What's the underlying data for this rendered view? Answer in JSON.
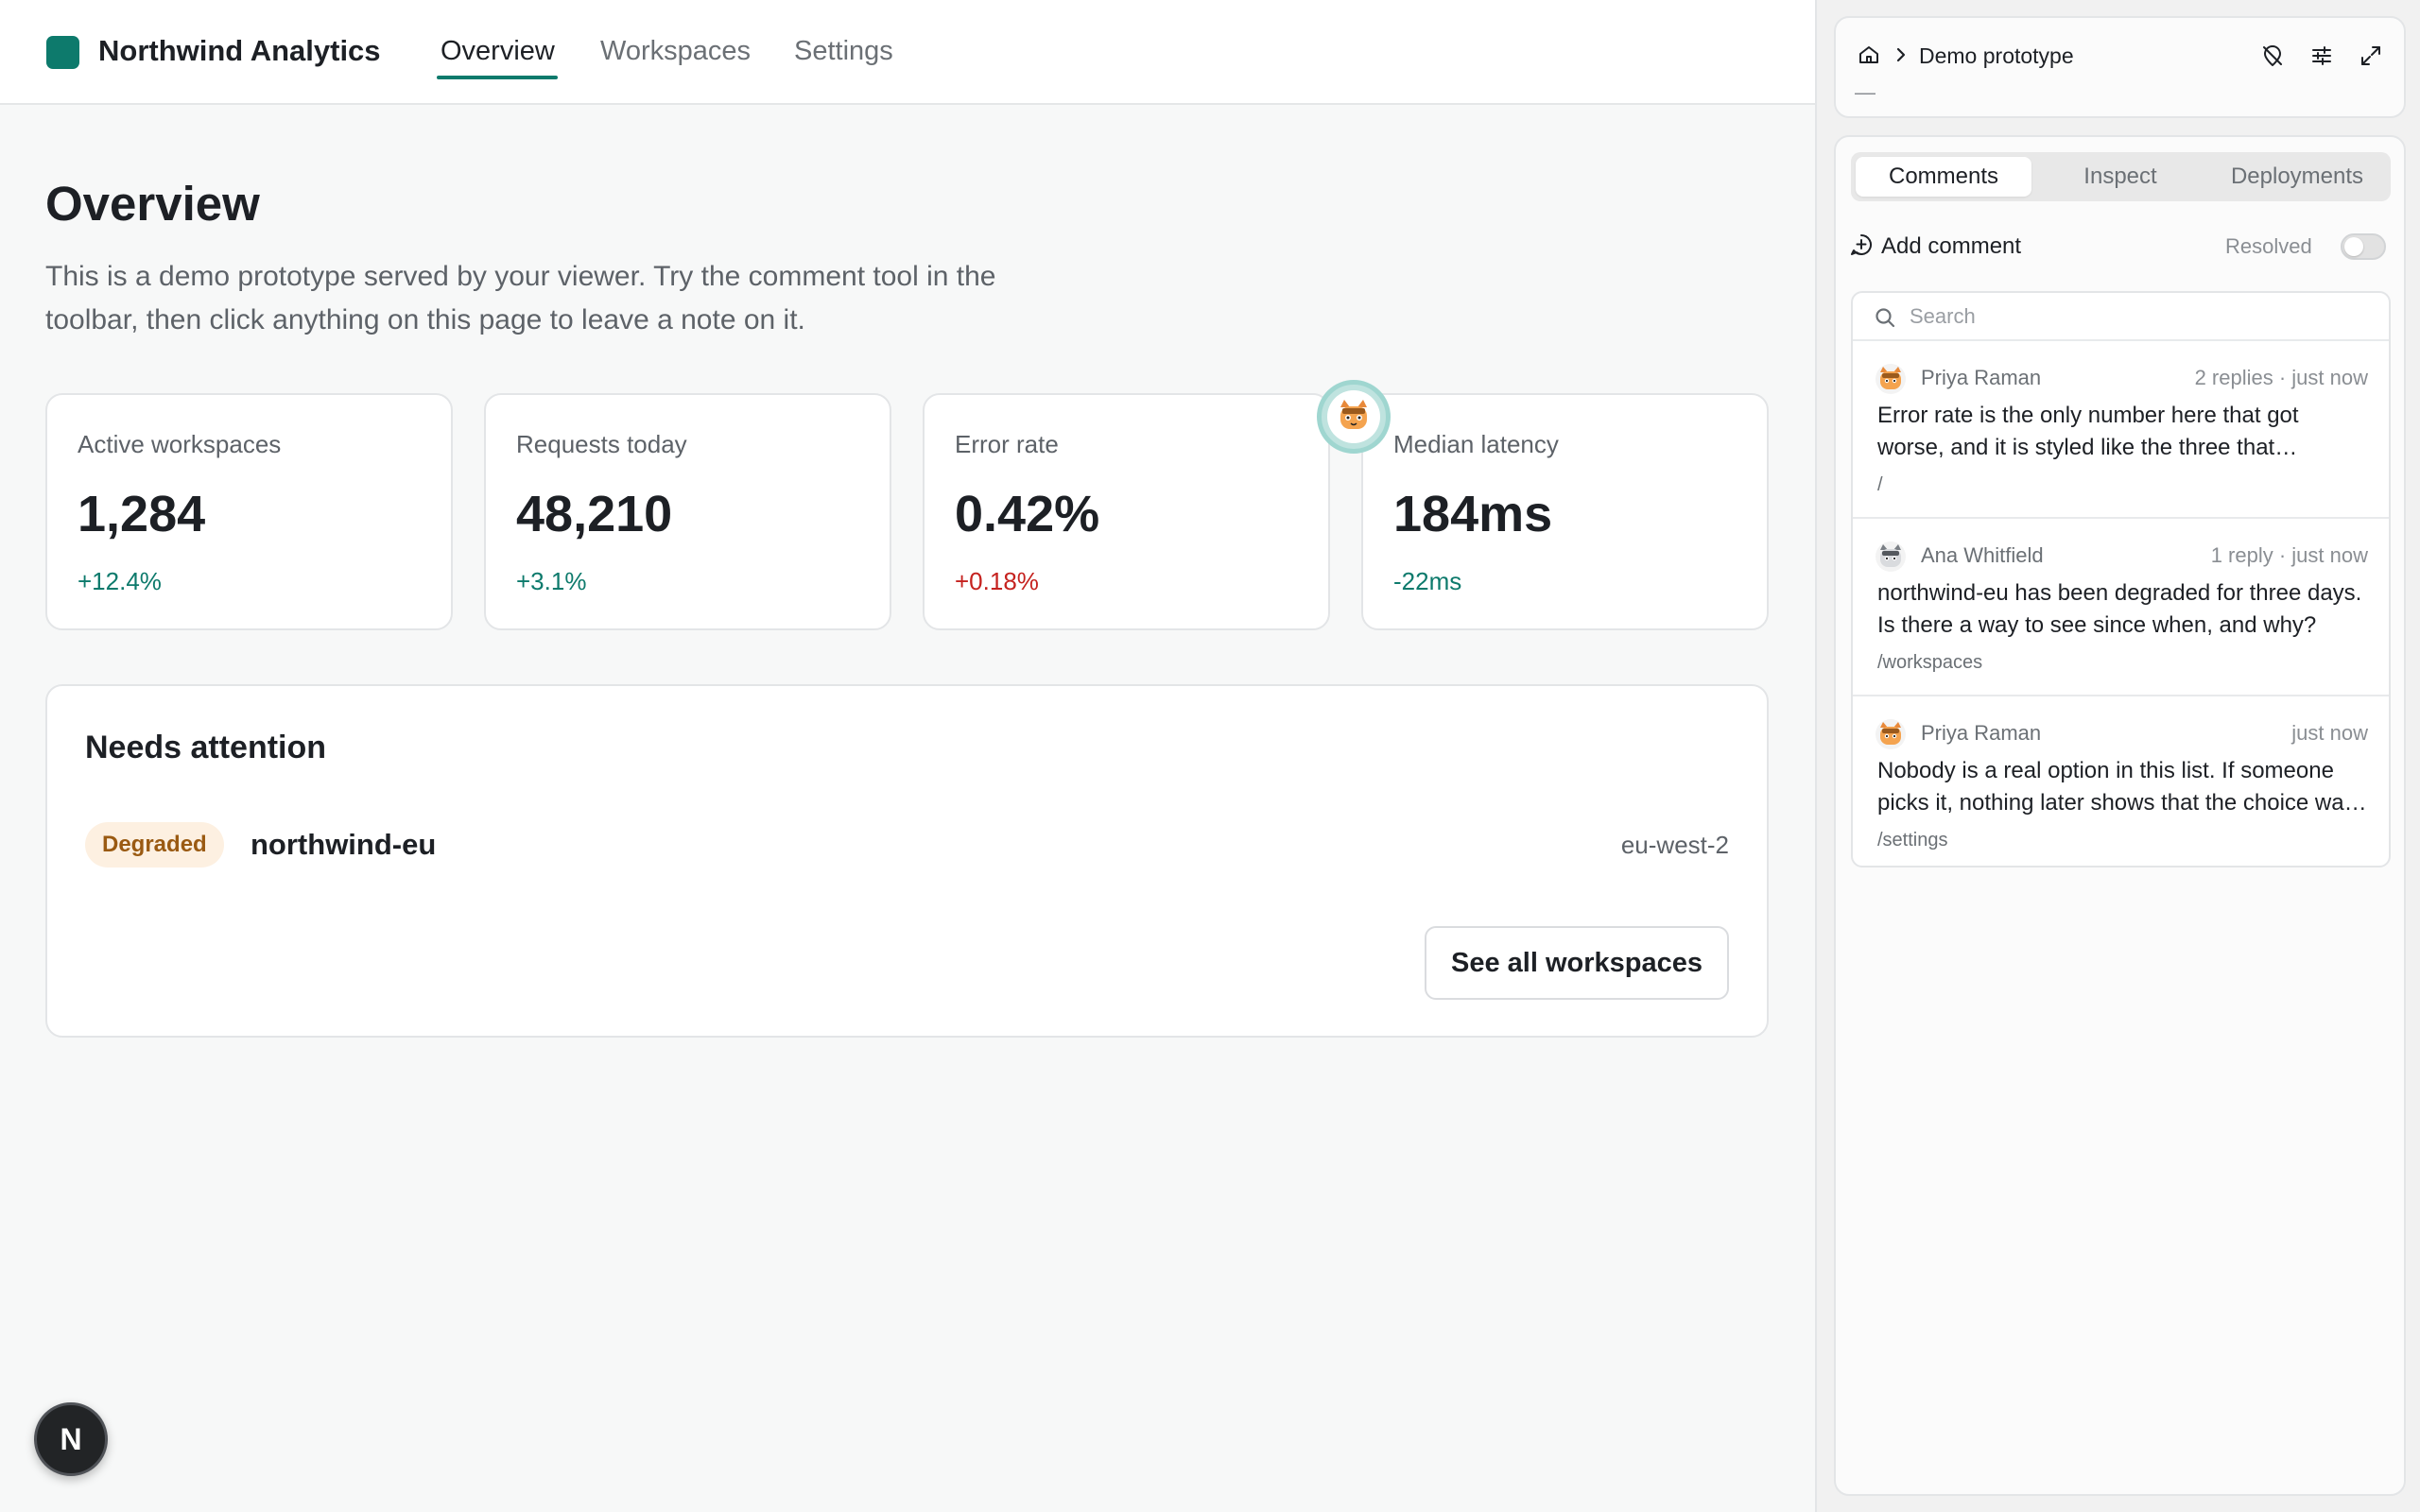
{
  "app": {
    "brand": "Northwind Analytics",
    "nav": [
      "Overview",
      "Workspaces",
      "Settings"
    ],
    "active_nav": "Overview",
    "accent": "#0d7a6c"
  },
  "page": {
    "title": "Overview",
    "description": "This is a demo prototype served by your viewer. Try the comment tool in the toolbar, then click anything on this page to leave a note on it."
  },
  "stats": [
    {
      "label": "Active workspaces",
      "value": "1,284",
      "delta": "+12.4%",
      "trend": "good"
    },
    {
      "label": "Requests today",
      "value": "48,210",
      "delta": "+3.1%",
      "trend": "good"
    },
    {
      "label": "Error rate",
      "value": "0.42%",
      "delta": "+0.18%",
      "trend": "bad"
    },
    {
      "label": "Median latency",
      "value": "184ms",
      "delta": "-22ms",
      "trend": "good"
    }
  ],
  "attention": {
    "title": "Needs attention",
    "status": "Degraded",
    "workspace": "northwind-eu",
    "region": "eu-west-2",
    "button": "See all workspaces"
  },
  "floating_button": "N",
  "panel": {
    "breadcrumb_title": "Demo prototype",
    "breadcrumb_sub": "—",
    "top_icons": [
      "hide-comments-icon",
      "settings-sliders-icon",
      "expand-icon"
    ],
    "tabs": [
      "Comments",
      "Inspect",
      "Deployments"
    ],
    "active_tab": "Comments",
    "add_comment": "Add comment",
    "resolved_label": "Resolved",
    "resolved_on": false,
    "search_placeholder": "Search",
    "comments": [
      {
        "author": "Priya Raman",
        "meta": "2 replies · just now",
        "body": "Error rate is the only number here that got worse, and it is styled like the three that improved.",
        "path": "/",
        "avatar": "cat-orange"
      },
      {
        "author": "Ana Whitfield",
        "meta": "1 reply · just now",
        "body": "northwind-eu has been degraded for three days. Is there a way to see since when, and why?",
        "path": "/workspaces",
        "avatar": "cat-grey"
      },
      {
        "author": "Priya Raman",
        "meta": "just now",
        "body": "Nobody is a real option in this list. If someone picks it, nothing later shows that the choice was made.",
        "path": "/settings",
        "avatar": "cat-orange"
      }
    ]
  },
  "colors": {
    "good": "#0d7a6c",
    "bad": "#c5221f",
    "badge_bg": "#fdf0e1",
    "badge_text": "#9a5a12"
  }
}
